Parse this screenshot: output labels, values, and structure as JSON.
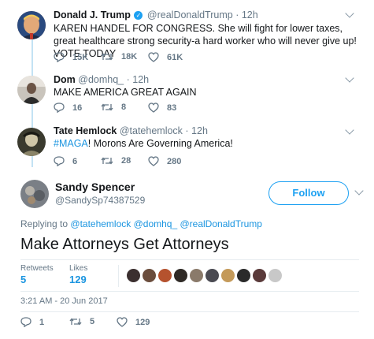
{
  "tweets": [
    {
      "name": "Donald J. Trump",
      "handle": "@realDonaldTrump",
      "time": "· 12h",
      "text": "KAREN HANDEL FOR CONGRESS. She will fight for lower taxes, great healthcare strong security-a hard worker who will never give up! VOTE TODAY",
      "replies": "15K",
      "retweets": "18K",
      "likes": "61K"
    },
    {
      "name": "Dom",
      "handle": "@domhq_",
      "time": "· 12h",
      "text": "MAKE AMERICA GREAT AGAIN",
      "replies": "16",
      "retweets": "8",
      "likes": "83"
    },
    {
      "name": "Tate Hemlock",
      "handle": "@tatehemlock",
      "time": "· 12h",
      "hashtag": "#MAGA",
      "text": "! Morons Are Governing America!",
      "replies": "6",
      "retweets": "28",
      "likes": "280"
    }
  ],
  "focus": {
    "name": "Sandy Spencer",
    "handle": "@SandySp74387529",
    "follow_label": "Follow",
    "replying_prefix": "Replying to",
    "mentions": "@tatehemlock @domhq_ @realDonaldTrump",
    "text": "Make Attorneys Get Attorneys",
    "retweets_label": "Retweets",
    "retweets_count": "5",
    "likes_label": "Likes",
    "likes_count": "129",
    "timestamp": "3:21 AM - 20 Jun 2017",
    "replies": "1",
    "retweets": "5",
    "likes": "129"
  },
  "colors": {
    "accent": "#1da1f2",
    "thread_line": "#c3e2f4",
    "muted": "#657786"
  },
  "icons": [
    "reply-icon",
    "retweet-icon",
    "like-icon",
    "caret-down-icon",
    "verified-badge-icon"
  ]
}
